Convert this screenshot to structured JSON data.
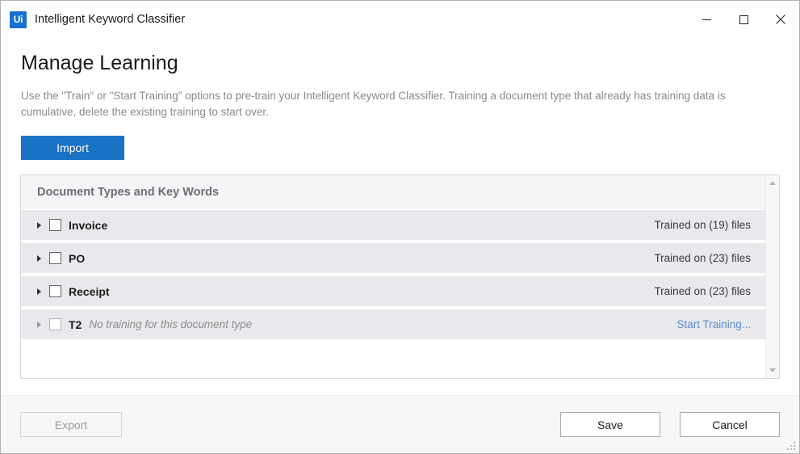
{
  "window": {
    "logo_text": "Ui",
    "title": "Intelligent Keyword Classifier",
    "controls": {
      "minimize": "minimize-icon",
      "maximize": "maximize-icon",
      "close": "close-icon"
    }
  },
  "page": {
    "title": "Manage Learning",
    "description": "Use the \"Train\" or \"Start Training\" options to pre-train your Intelligent Keyword Classifier. Training a document type that already has training data is cumulative, delete the existing training to start over.",
    "import_label": "Import"
  },
  "list": {
    "header": "Document Types and Key Words",
    "rows": [
      {
        "label": "Invoice",
        "note": "",
        "status": "Trained on (19) files",
        "action": "",
        "checked": false,
        "expanded": false,
        "trained": true
      },
      {
        "label": "PO",
        "note": "",
        "status": "Trained on (23) files",
        "action": "",
        "checked": false,
        "expanded": false,
        "trained": true
      },
      {
        "label": "Receipt",
        "note": "",
        "status": "Trained on (23) files",
        "action": "",
        "checked": false,
        "expanded": false,
        "trained": true
      },
      {
        "label": "T2",
        "note": "No training for this document type",
        "status": "",
        "action": "Start Training...",
        "checked": false,
        "expanded": false,
        "trained": false
      }
    ],
    "scrollbar": {
      "up": "scroll-up-arrow-icon",
      "down": "scroll-down-arrow-icon"
    }
  },
  "footer": {
    "export_label": "Export",
    "export_disabled": true,
    "save_label": "Save",
    "cancel_label": "Cancel"
  },
  "colors": {
    "accent": "#1a72c4",
    "link": "#5b8fd0",
    "row_background": "#e9e8ec",
    "logo_background": "#1a6fd4"
  }
}
